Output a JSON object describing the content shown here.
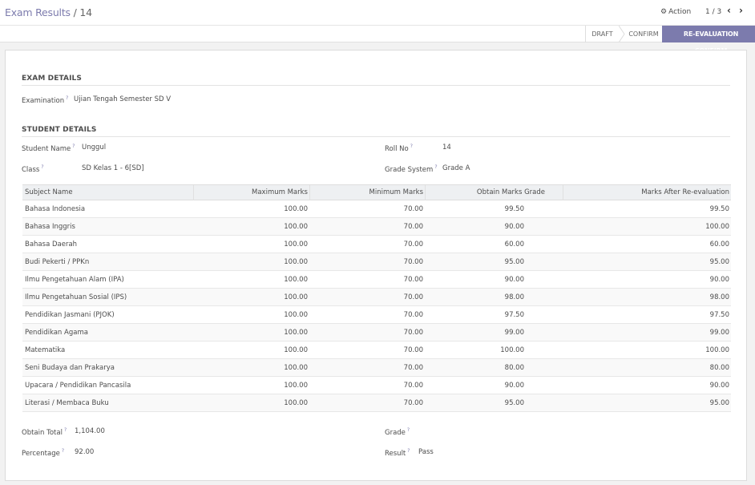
{
  "breadcrumb": {
    "parent": "Exam Results",
    "separator": " / ",
    "current": "14"
  },
  "toolbar": {
    "action_label": "Action",
    "pager_text": "1 / 3",
    "prev_icon": "chevron-left-icon",
    "next_icon": "chevron-right-icon",
    "gear_icon": "gear-icon"
  },
  "statusbar": {
    "steps": [
      "DRAFT",
      "CONFIRM",
      "RE-EVALUATION CONFIRM"
    ],
    "active": "RE-EVALUATION CONFIRM",
    "active_color": "#7c7bad"
  },
  "exam_details": {
    "title": "EXAM DETAILS",
    "examination_label": "Examination",
    "examination_value": "Ujian Tengah Semester SD V"
  },
  "student_details": {
    "title": "STUDENT DETAILS",
    "student_name_label": "Student Name",
    "student_name_value": "Unggul",
    "roll_no_label": "Roll No",
    "roll_no_value": "14",
    "class_label": "Class",
    "class_value": "SD Kelas 1 - 6[SD]",
    "grade_system_label": "Grade System",
    "grade_system_value": "Grade A",
    "help_mark": "?"
  },
  "table": {
    "columns": [
      "Subject Name",
      "Maximum Marks",
      "Minimum Marks",
      "Obtain Marks Grade",
      "Marks After Re-evaluation"
    ],
    "rows": [
      [
        "Bahasa Indonesia",
        "100.00",
        "70.00",
        "99.50",
        "99.50"
      ],
      [
        "Bahasa Inggris",
        "100.00",
        "70.00",
        "90.00",
        "100.00"
      ],
      [
        "Bahasa Daerah",
        "100.00",
        "70.00",
        "60.00",
        "60.00"
      ],
      [
        "Budi Pekerti / PPKn",
        "100.00",
        "70.00",
        "95.00",
        "95.00"
      ],
      [
        "Ilmu Pengetahuan Alam (IPA)",
        "100.00",
        "70.00",
        "90.00",
        "90.00"
      ],
      [
        "Ilmu Pengetahuan Sosial (IPS)",
        "100.00",
        "70.00",
        "98.00",
        "98.00"
      ],
      [
        "Pendidikan Jasmani (PJOK)",
        "100.00",
        "70.00",
        "97.50",
        "97.50"
      ],
      [
        "Pendidikan Agama",
        "100.00",
        "70.00",
        "99.00",
        "99.00"
      ],
      [
        "Matematika",
        "100.00",
        "70.00",
        "100.00",
        "100.00"
      ],
      [
        "Seni Budaya dan Prakarya",
        "100.00",
        "70.00",
        "80.00",
        "80.00"
      ],
      [
        "Upacara / Pendidikan Pancasila",
        "100.00",
        "70.00",
        "90.00",
        "90.00"
      ],
      [
        "Literasi / Membaca Buku",
        "100.00",
        "70.00",
        "95.00",
        "95.00"
      ]
    ]
  },
  "summary": {
    "obtain_total_label": "Obtain Total",
    "obtain_total_value": "1,104.00",
    "percentage_label": "Percentage",
    "percentage_value": "92.00",
    "grade_label": "Grade",
    "grade_value": "",
    "result_label": "Result",
    "result_value": "Pass"
  }
}
